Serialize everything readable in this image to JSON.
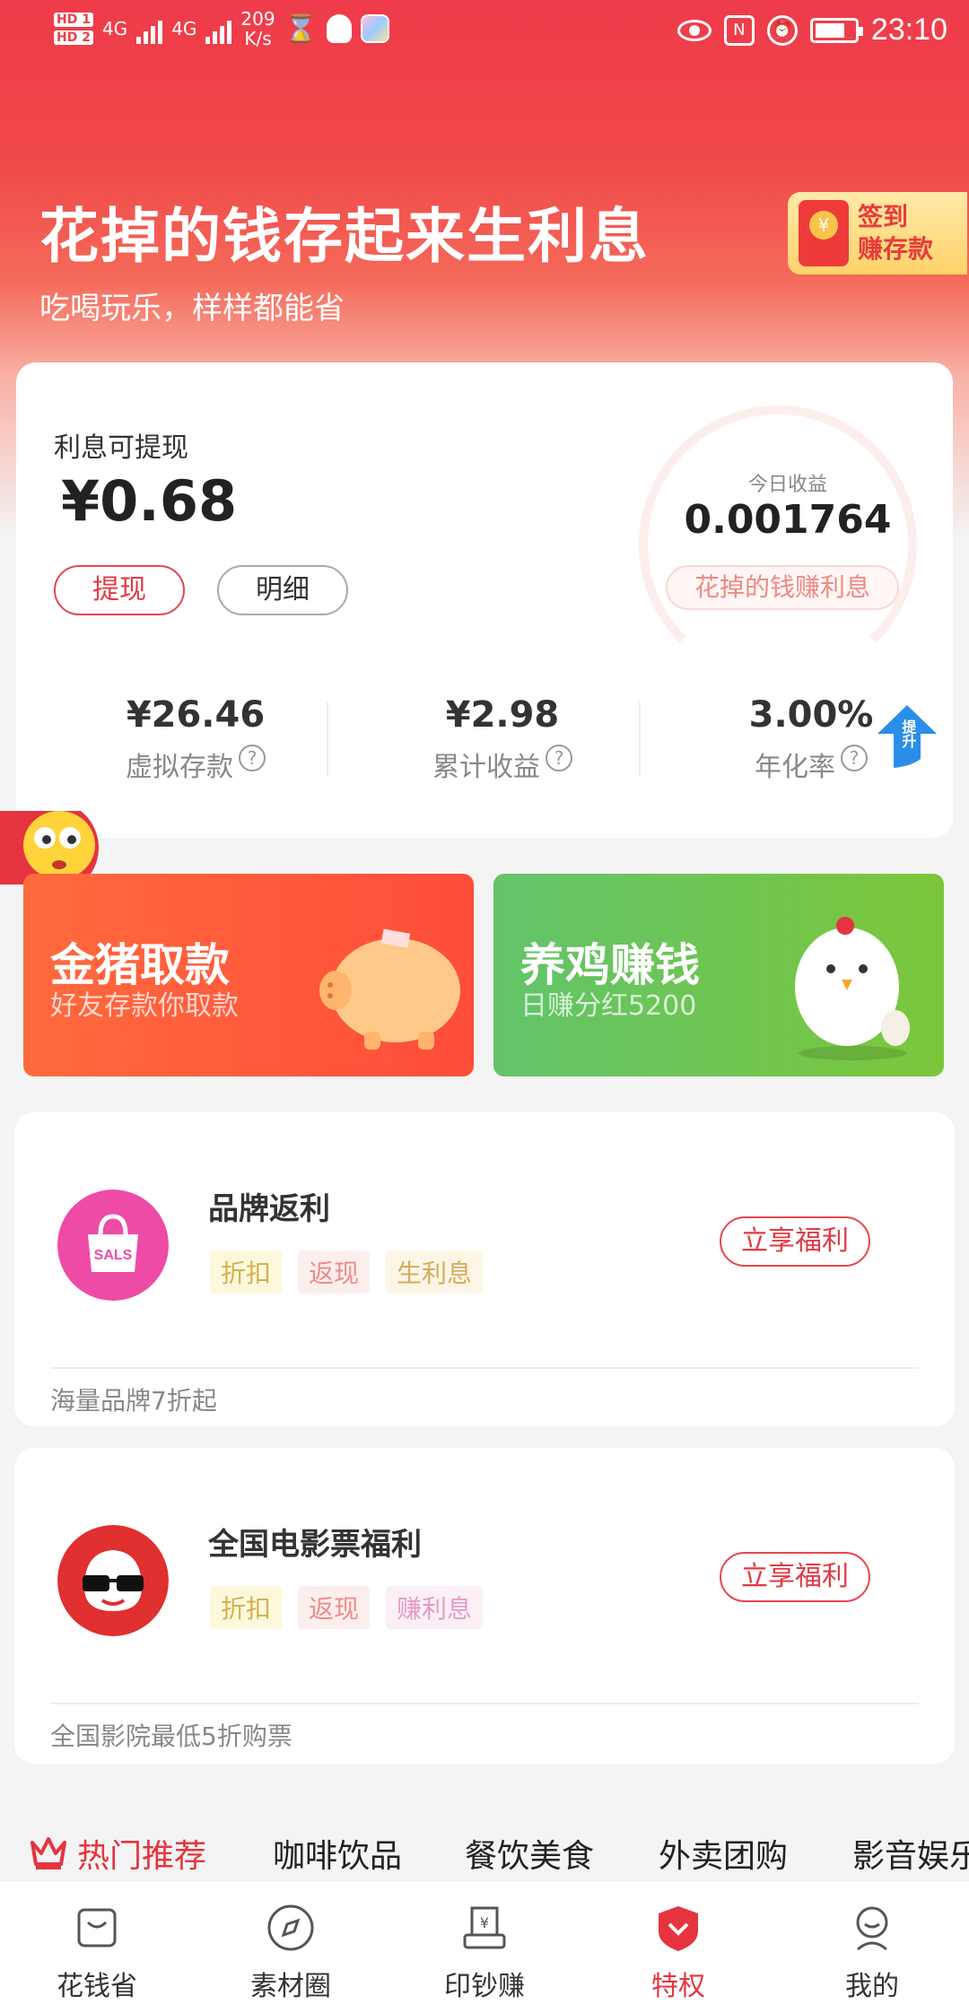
{
  "status_bar": {
    "hd1": "HD 1",
    "hd2": "HD 2",
    "net1": "4G",
    "net2": "4G",
    "speed": "209",
    "speed_unit": "K/s",
    "nfc": "N",
    "time": "23:10"
  },
  "hero": {
    "title": "花掉的钱存起来生利息",
    "subtitle": "吃喝玩乐，样样都能省",
    "signin_line1": "签到",
    "signin_line2": "赚存款"
  },
  "interest_card": {
    "label": "利息可提现",
    "amount": "¥0.68",
    "withdraw_button": "提现",
    "detail_button": "明细",
    "today_label": "今日收益",
    "today_value": "0.001764",
    "earn_tag": "花掉的钱赚利息",
    "stats": [
      {
        "value": "¥26.46",
        "label": "虚拟存款"
      },
      {
        "value": "¥2.98",
        "label": "累计收益"
      },
      {
        "value": "3.00%",
        "label": "年化率"
      }
    ],
    "upgrade_badge": "提升"
  },
  "promos": [
    {
      "title": "金猪取款",
      "subtitle": "好友存款你取款"
    },
    {
      "title": "养鸡赚钱",
      "subtitle": "日赚分红5200"
    }
  ],
  "list_items": [
    {
      "title": "品牌返利",
      "logo_text": "SALS",
      "tags": [
        "折扣",
        "返现",
        "生利息"
      ],
      "action": "立享福利",
      "footer": "海量品牌7折起"
    },
    {
      "title": "全国电影票福利",
      "tags": [
        "折扣",
        "返现",
        "赚利息"
      ],
      "action": "立享福利",
      "footer": "全国影院最低5折购票"
    }
  ],
  "categories": [
    "热门推荐",
    "咖啡饮品",
    "餐饮美食",
    "外卖团购",
    "影音娱乐"
  ],
  "bottom_nav": [
    {
      "label": "花钱省",
      "icon": "bag-icon"
    },
    {
      "label": "素材圈",
      "icon": "compass-icon"
    },
    {
      "label": "印钞赚",
      "icon": "printer-icon"
    },
    {
      "label": "特权",
      "icon": "privilege-icon"
    },
    {
      "label": "我的",
      "icon": "profile-icon"
    }
  ],
  "colors": {
    "brand_red": "#e5343f",
    "green": "#6cc45a",
    "orange": "#ff5a3a"
  }
}
